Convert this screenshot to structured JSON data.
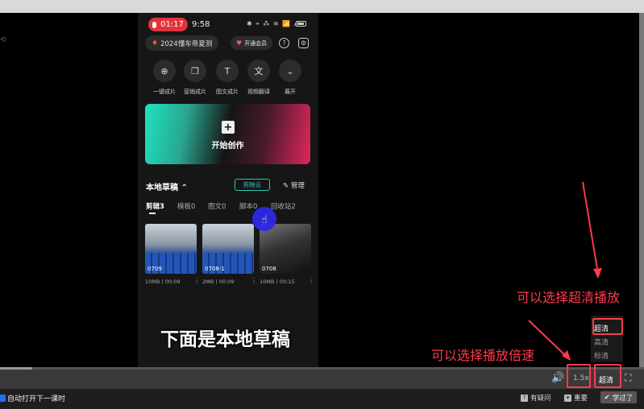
{
  "phone": {
    "status": {
      "rec_time": "01:17",
      "clock": "9:58",
      "icons": "✱ ⌖ ⁂ ≋ 📶 ₄ᴳ"
    },
    "tag": "2024懂车帝夏测",
    "vip": "开通会员",
    "help_icon": "?",
    "settings_icon": "⚙",
    "tools": [
      {
        "label": "一键成片",
        "icon": "⊕"
      },
      {
        "label": "营销成片",
        "icon": "❐"
      },
      {
        "label": "图文成片",
        "icon": "T"
      },
      {
        "label": "视频翻译",
        "icon": "文"
      },
      {
        "label": "展开",
        "icon": "⌄"
      }
    ],
    "create_label": "开始创作",
    "drafts_title": "本地草稿 ⌃",
    "cloud_label": "剪映云",
    "manage_label": "✎ 管理",
    "tabs": [
      "剪辑3",
      "模板0",
      "图文0",
      "脚本0",
      "回收站2"
    ],
    "drafts": [
      {
        "name": "0709",
        "meta": "10MB丨00:09"
      },
      {
        "name": "0708-1",
        "meta": "2MB丨00:09"
      },
      {
        "name": "0708",
        "meta": "10MB丨00:15"
      }
    ]
  },
  "subtitle": "下面是本地草稿",
  "annotations": {
    "quality_note": "可以选择超清播放",
    "speed_note": "可以选择播放倍速"
  },
  "quality_menu": {
    "options": [
      "超清",
      "高清",
      "标清"
    ],
    "selected": "超清"
  },
  "controls": {
    "volume_icon": "🔊",
    "speed": "1.5x",
    "quality": "超清",
    "fullscreen_icon": "⛶",
    "progress": 0.05
  },
  "footer": {
    "autoplay": "自动打开下一课时",
    "question": "有疑问",
    "important": "重要",
    "learned": "学过了"
  },
  "colors": {
    "accent_red": "#ff3b4c",
    "cloud": "#2ec4b6",
    "record": "#e0343d"
  }
}
